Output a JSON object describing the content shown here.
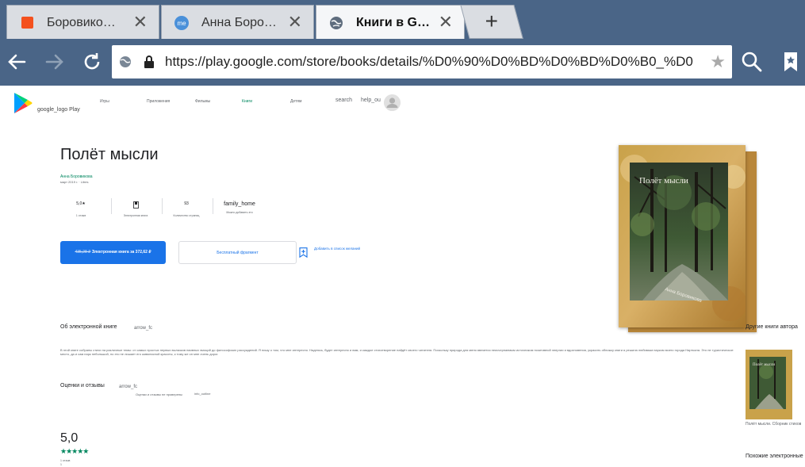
{
  "browser": {
    "tabs": [
      {
        "title": "Боровико…",
        "favicon": "orange-square-icon",
        "active": false
      },
      {
        "title": "Анна Боро…",
        "favicon": "me-circle-icon",
        "active": false
      },
      {
        "title": "Книги в G…",
        "favicon": "globe-icon",
        "active": true
      }
    ],
    "new_tab_label": "+",
    "url": "https://play.google.com/store/books/details/%D0%90%D0%BD%D0%BD%D0%B0_%D0",
    "colors": {
      "chrome": "#4a6587"
    }
  },
  "header": {
    "logo_text": "google_logo Play",
    "nav": [
      {
        "label": "Игры",
        "active": false
      },
      {
        "label": "Приложения",
        "active": false
      },
      {
        "label": "Фильмы",
        "active": false
      },
      {
        "label": "Книги",
        "active": true
      },
      {
        "label": "Детям",
        "active": false
      }
    ],
    "search_label": "search",
    "help_label": "help_ou"
  },
  "book": {
    "title": "Полёт мысли",
    "author": "Анна Боровикова",
    "pub_info": "март 2019 г. · Litres",
    "stats": [
      {
        "value": "5,0★",
        "label": "1 отзыв"
      },
      {
        "value": "",
        "label": "Электронная книга",
        "icon": "book-icon"
      },
      {
        "value": "93",
        "label": "Количество страниц"
      },
      {
        "value": "family_home",
        "label": "Можно добавить   это"
      }
    ],
    "buy_old_price": "435,28 ₽",
    "buy_label": "Электронная книга за 372,62 ₽",
    "free_label": "Бесплатный фрагмент",
    "wishlist_label": "Добавить в список желаний",
    "cover_title": "Полёт мысли",
    "cover_author": "Анна Боровикова"
  },
  "about": {
    "title": "Об электронной книге",
    "arrow": "arrow_fc",
    "description": "В этой книге собраны стихи на различные темы: от самых простых первых вылазков наивных эмоций до философских рассуждений. Я пишу о том, что мне интересно. Надеюсь, будет интересно и вам, и каждое стихотворение найдёт своего читателя. Поскольку природа для меня является неисчерпаемым источником позитивной энергии и вдохновения, украсить обложку книги я решила любимым парком моего города Нарткала. Это не туристическое место, да и сам парк небольшой, но это не лишает его живописной красоты, к тому же он мне очень дорог."
  },
  "reviews": {
    "title": "Оценки и отзывы",
    "arrow": "arrow_fc",
    "note": "Оценки и отзывы не проверены",
    "info": "info_outline",
    "rating": "5,0",
    "stars": "★★★★★",
    "count": "1 отзыв",
    "count_extra": "1"
  },
  "sidebar": {
    "other_books_title": "Другие книги автора",
    "other_book_caption": "Полёт мысли. Сборник стихов",
    "similar_title": "Похожие электронные"
  }
}
